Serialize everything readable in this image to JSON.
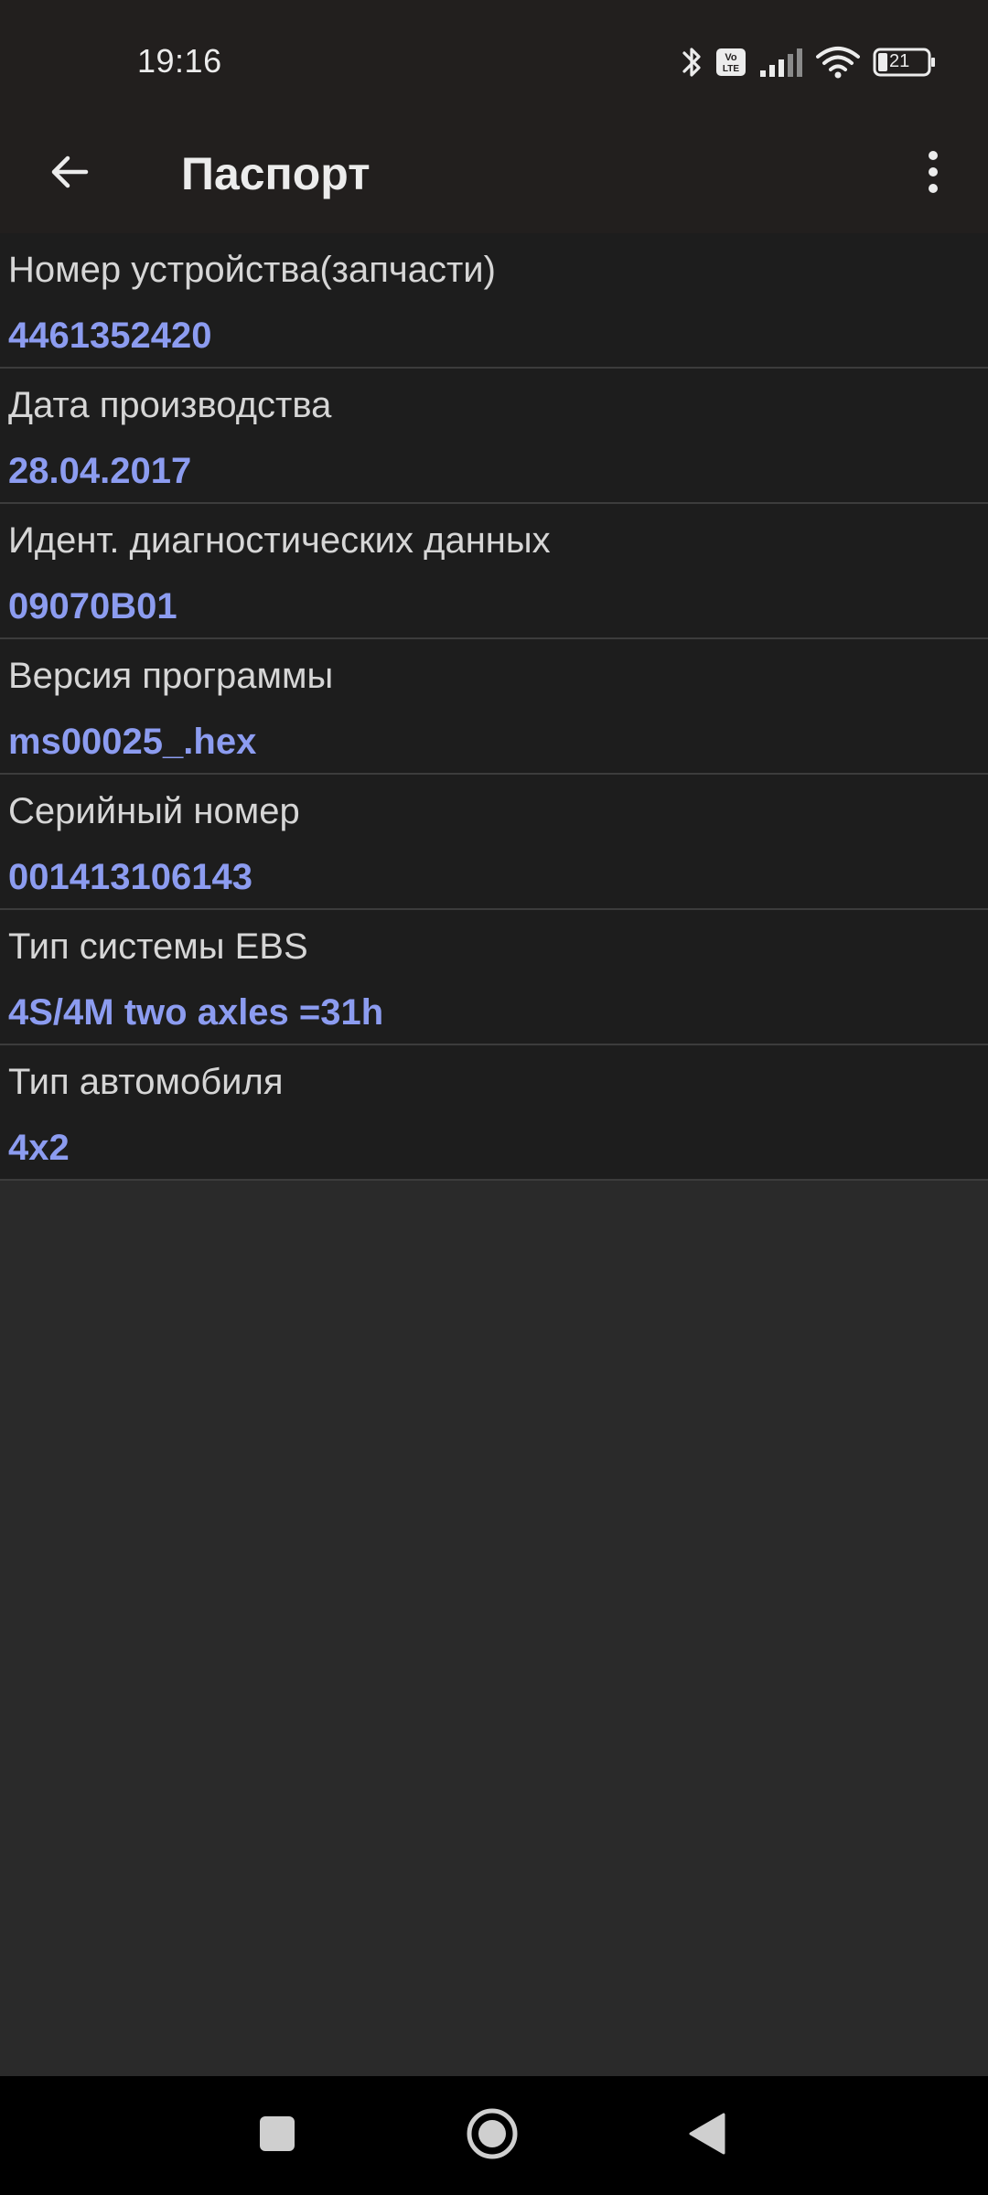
{
  "status_bar": {
    "time": "19:16",
    "icons": [
      "bluetooth-icon",
      "volte-icon",
      "signal-icon",
      "wifi-icon",
      "battery-icon"
    ],
    "volte_text": "Vo LTE",
    "battery_level": "21"
  },
  "app_bar": {
    "title": "Паспорт",
    "back_icon": "arrow-left-icon",
    "menu_icon": "more-vert-icon"
  },
  "info": {
    "items": [
      {
        "label": "Номер устройства(запчасти)",
        "value": "4461352420"
      },
      {
        "label": "Дата производства",
        "value": "28.04.2017"
      },
      {
        "label": "Идент. диагностических данных",
        "value": "09070B01"
      },
      {
        "label": "Версия программы",
        "value": "ms00025_.hex"
      },
      {
        "label": "Серийный номер",
        "value": "001413106143"
      },
      {
        "label": "Тип системы EBS",
        "value": "4S/4M two axles =31h"
      },
      {
        "label": "Тип автомобиля",
        "value": "4x2"
      }
    ]
  },
  "nav_bar": {
    "icons": [
      "recents-square-icon",
      "home-circle-icon",
      "back-triangle-icon"
    ]
  },
  "colors": {
    "bar_background": "#221f1e",
    "list_background": "#1d1d1d",
    "page_background": "#2a2a2a",
    "value_accent": "#8c9cf0",
    "divider": "#3c3c3c"
  }
}
